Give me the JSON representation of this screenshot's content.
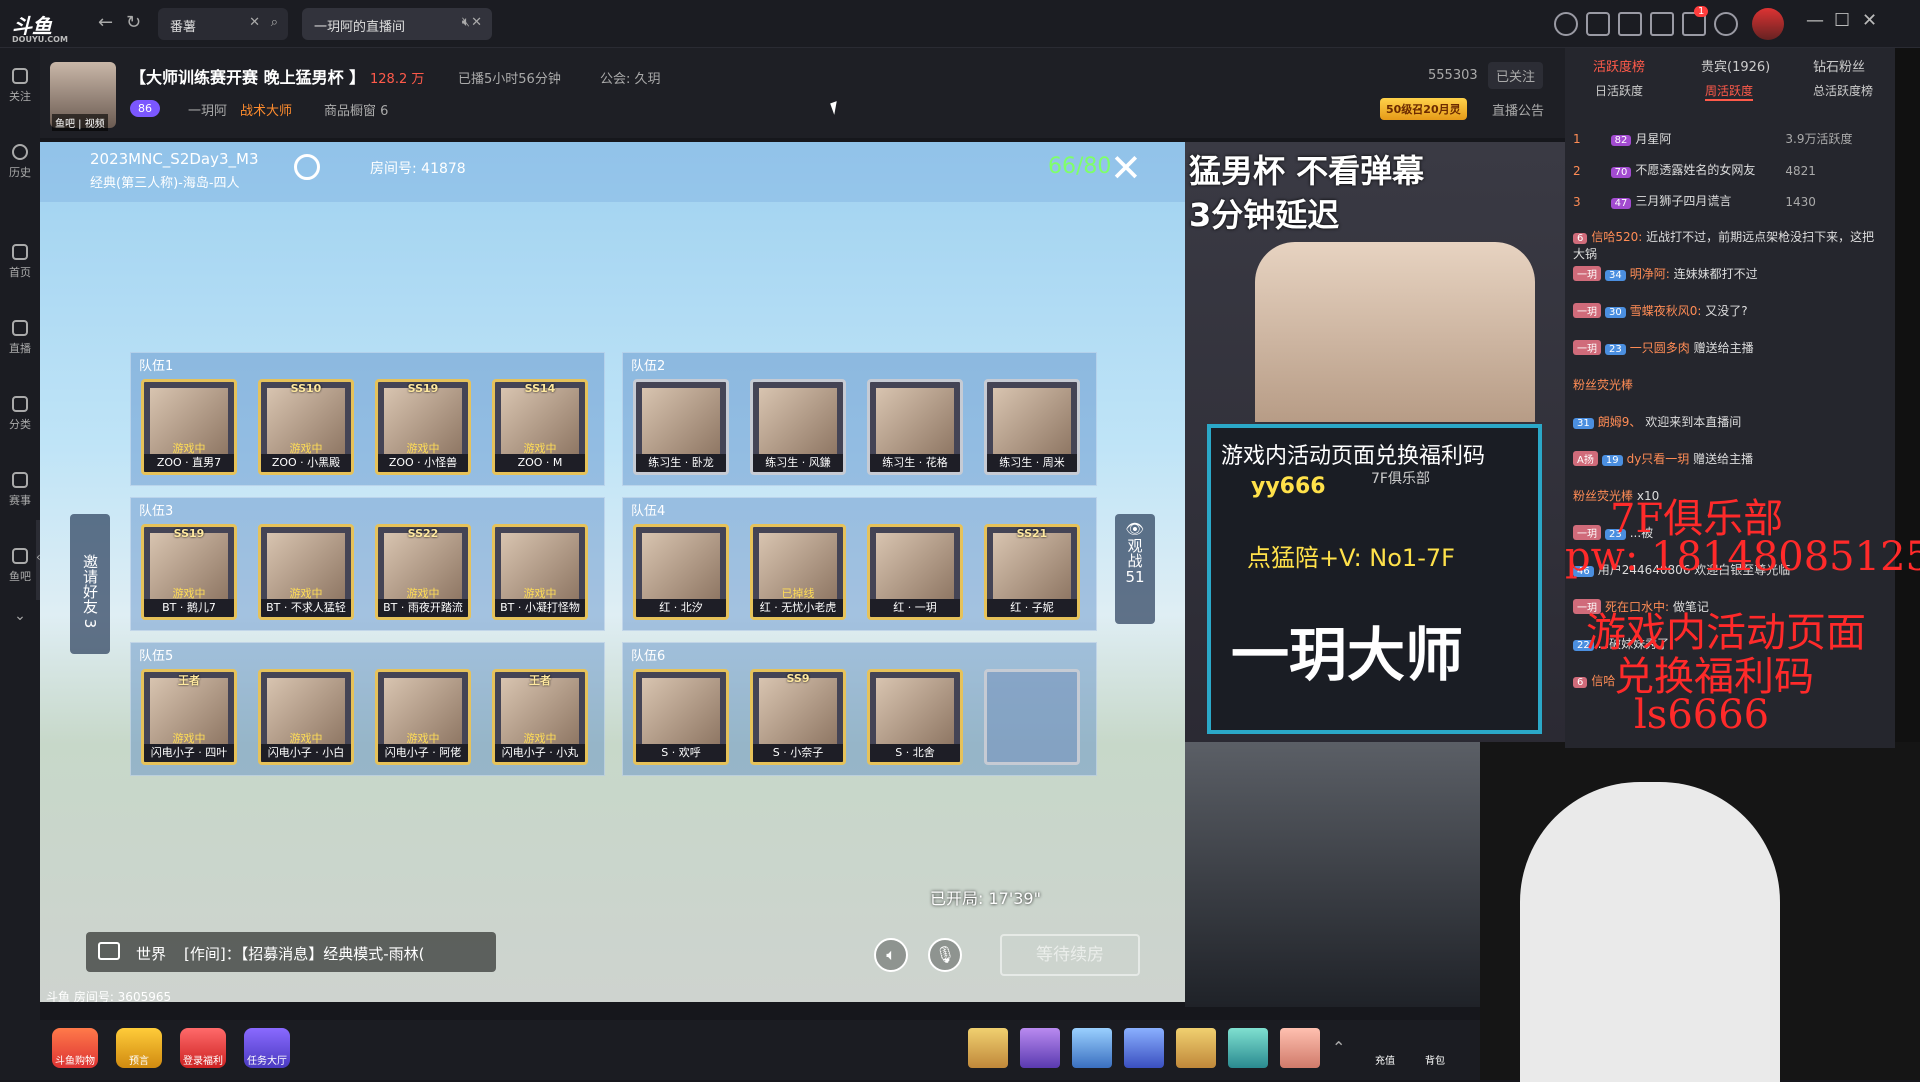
{
  "topbar": {
    "logo": "斗鱼",
    "logo_sub": "DOUYU.COM",
    "tabs": [
      {
        "label": "番薯"
      },
      {
        "label": "一玥阿的直播间"
      }
    ],
    "notif_count": "1"
  },
  "leftrail": [
    {
      "label": "关注"
    },
    {
      "label": "历史"
    },
    {
      "label": "首页"
    },
    {
      "label": "直播"
    },
    {
      "label": "分类"
    },
    {
      "label": "赛事"
    },
    {
      "label": "鱼吧"
    }
  ],
  "stream": {
    "title": "【大师训练赛开赛 晚上猛男杯 】",
    "heat": "128.2 万",
    "duration": "已播5小时56分钟",
    "guild": "公会: 久玥",
    "level": "86",
    "streamer": "一玥阿",
    "tag": "战术大师",
    "shop": "商品橱窗 6",
    "room_id": "555303",
    "follow": "已关注",
    "fan_badge": "50级召20月灵",
    "notice": "直播公告",
    "avatar_label": "鱼吧 | 视频"
  },
  "game": {
    "match_name": "2023MNC_S2Day3_M3",
    "mode": "经典(第三人称)-海岛-四人",
    "room_label": "房间号: 41878",
    "players": "66/80",
    "invite": "邀请好友",
    "invite_count": "3",
    "spectate": "观战",
    "spectate_count": "51",
    "started": "已开局: 17'39\"",
    "chat_channel": "世界",
    "chat_line": "[作间]：【招募消息】经典模式-雨林(",
    "wait_btn": "等待续房",
    "bottom_room": "斗鱼 房间号: 3605965",
    "teams": [
      {
        "label": "队伍1",
        "players": [
          {
            "rank": "",
            "status": "游戏中",
            "name": "ZOO · 直男7"
          },
          {
            "rank": "SS10",
            "status": "游戏中",
            "name": "ZOO · 小黑殿"
          },
          {
            "rank": "SS19",
            "status": "游戏中",
            "name": "ZOO · 小怪兽"
          },
          {
            "rank": "SS14",
            "status": "游戏中",
            "name": "ZOO · M"
          }
        ]
      },
      {
        "label": "队伍2",
        "players": [
          {
            "rank": "",
            "status": "",
            "name": "练习生 · 卧龙"
          },
          {
            "rank": "",
            "status": "",
            "name": "练习生 · 风鎌"
          },
          {
            "rank": "",
            "status": "",
            "name": "练习生 · 花格"
          },
          {
            "rank": "",
            "status": "",
            "name": "练习生 · 周米"
          }
        ]
      },
      {
        "label": "队伍3",
        "players": [
          {
            "rank": "SS19",
            "status": "游戏中",
            "name": "BT · 鹅儿7"
          },
          {
            "rank": "",
            "status": "游戏中",
            "name": "BT · 不求人猛轻"
          },
          {
            "rank": "SS22",
            "status": "游戏中",
            "name": "BT · 雨夜开踏流"
          },
          {
            "rank": "",
            "status": "游戏中",
            "name": "BT · 小凝打怪物"
          }
        ]
      },
      {
        "label": "队伍4",
        "players": [
          {
            "rank": "",
            "status": "",
            "name": "红 · 北汐"
          },
          {
            "rank": "",
            "status": "已掉线",
            "name": "红 · 无忧小老虎"
          },
          {
            "rank": "",
            "status": "",
            "name": "红 · 一玥"
          },
          {
            "rank": "SS21",
            "status": "",
            "name": "红 · 子妮"
          }
        ]
      },
      {
        "label": "队伍5",
        "players": [
          {
            "rank": "王者",
            "status": "游戏中",
            "name": "闪电小子 · 四叶"
          },
          {
            "rank": "",
            "status": "游戏中",
            "name": "闪电小子 · 小白"
          },
          {
            "rank": "",
            "status": "游戏中",
            "name": "闪电小子 · 阿佬"
          },
          {
            "rank": "王者",
            "status": "游戏中",
            "name": "闪电小子 · 小丸"
          }
        ]
      },
      {
        "label": "队伍6",
        "players": [
          {
            "rank": "",
            "status": "",
            "name": "S · 欢呼"
          },
          {
            "rank": "SS9",
            "status": "",
            "name": "S · 小奈子"
          },
          {
            "rank": "",
            "status": "",
            "name": "S · 北舍"
          }
        ]
      }
    ]
  },
  "promo": {
    "line1": "猛男杯 不看弹幕",
    "line2": "3分钟延迟",
    "card_line1": "游戏内活动页面兑换福利码",
    "card_code": "yy666",
    "card_line2": "点猛陪+V: No1-7F",
    "card_brand": "一玥大师",
    "club": "7F俱乐部"
  },
  "chat": {
    "tabs": [
      "活跃度榜",
      "贵宾(1926)",
      "钻石粉丝"
    ],
    "subtabs": [
      "日活跃度",
      "周活跃度",
      "总活跃度榜"
    ],
    "ranks": [
      {
        "n": "1",
        "lvl": "82",
        "name": "月星阿",
        "score": "3.9万活跃度"
      },
      {
        "n": "2",
        "lvl": "70",
        "name": "不愿透露姓名的女网友",
        "score": "4821"
      },
      {
        "n": "3",
        "lvl": "47",
        "name": "三月狮子四月谎言",
        "score": "1430"
      }
    ],
    "messages": [
      {
        "fan": "6",
        "user": "信哈520:",
        "text": "近战打不过，前期远点架枪没扫下来，这把大锅"
      },
      {
        "fan": "一玥",
        "badge": "34",
        "user": "明净阿:",
        "text": "连妹妹都打不过"
      },
      {
        "fan": "一玥",
        "badge": "30",
        "user": "雪蝶夜秋风0:",
        "text": "又没了?"
      },
      {
        "fan": "一玥",
        "badge": "23",
        "user": "一只圆多肉",
        "text": "赠送给主播"
      },
      {
        "fan": "",
        "badge": "",
        "user": "粉丝荧光棒",
        "text": ""
      },
      {
        "fan": "",
        "badge": "31",
        "user": "朗姆9、",
        "text": "欢迎来到本直播间"
      },
      {
        "fan": "A扬",
        "badge": "19",
        "user": "dy只看一玥",
        "text": "赠送给主播"
      },
      {
        "fan": "",
        "badge": "",
        "user": "粉丝荧光棒",
        "text": "x10"
      },
      {
        "fan": "一玥",
        "badge": "23",
        "user": "",
        "text": "...被"
      },
      {
        "fan": "",
        "badge": "46",
        "user": "",
        "text": "用户244640806 欢迎白银至尊光临"
      },
      {
        "fan": "一玥",
        "badge": "",
        "user": "死在口水中:",
        "text": "做笔记"
      },
      {
        "fan": "",
        "badge": "22",
        "user": "",
        "text": "...破妹妹秀了"
      },
      {
        "fan": "6",
        "badge": "",
        "user": "信哈",
        "text": ""
      }
    ]
  },
  "overlay": {
    "club": "7F俱乐部",
    "pw": "pw: 18148085125",
    "line1": "游戏内活动页面",
    "line2": "兑换福利码",
    "code": "ls6666"
  },
  "bottombar": {
    "items": [
      "斗鱼购物",
      "预言",
      "登录福利",
      "任务大厅"
    ],
    "right": [
      "充值",
      "背包"
    ]
  }
}
